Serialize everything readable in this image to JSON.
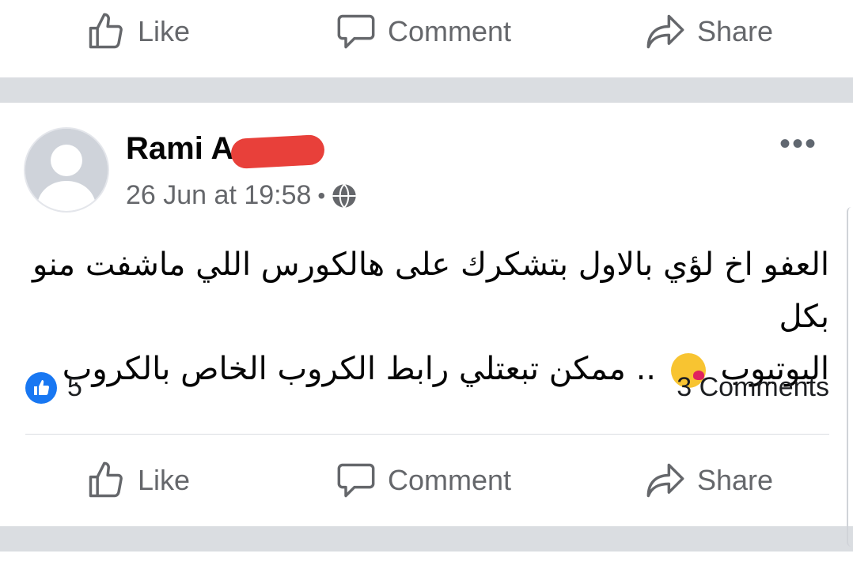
{
  "top_actions": {
    "like": "Like",
    "comment": "Comment",
    "share": "Share"
  },
  "post": {
    "author": "Rami A",
    "timestamp": "26 Jun at 19:58",
    "separator_dot": "•",
    "privacy_icon": "globe-icon",
    "more_label": "•••",
    "text_line1": "العفو اخ لؤي بالاول بتشكرك على هالكورس اللي ماشفت منو بكل",
    "text_line2_a": "اليوتيوب",
    "text_line2_b": ".. ممكن تبعتلي رابط الكروب الخاص بالكروب",
    "emoji": "kissing-face-with-heart",
    "reactions_count": "5",
    "comments_count": "3 Comments",
    "actions": {
      "like": "Like",
      "comment": "Comment",
      "share": "Share"
    }
  },
  "colors": {
    "accent": "#1877f2",
    "secondary_text": "#65676b",
    "separator": "#dadde1"
  }
}
